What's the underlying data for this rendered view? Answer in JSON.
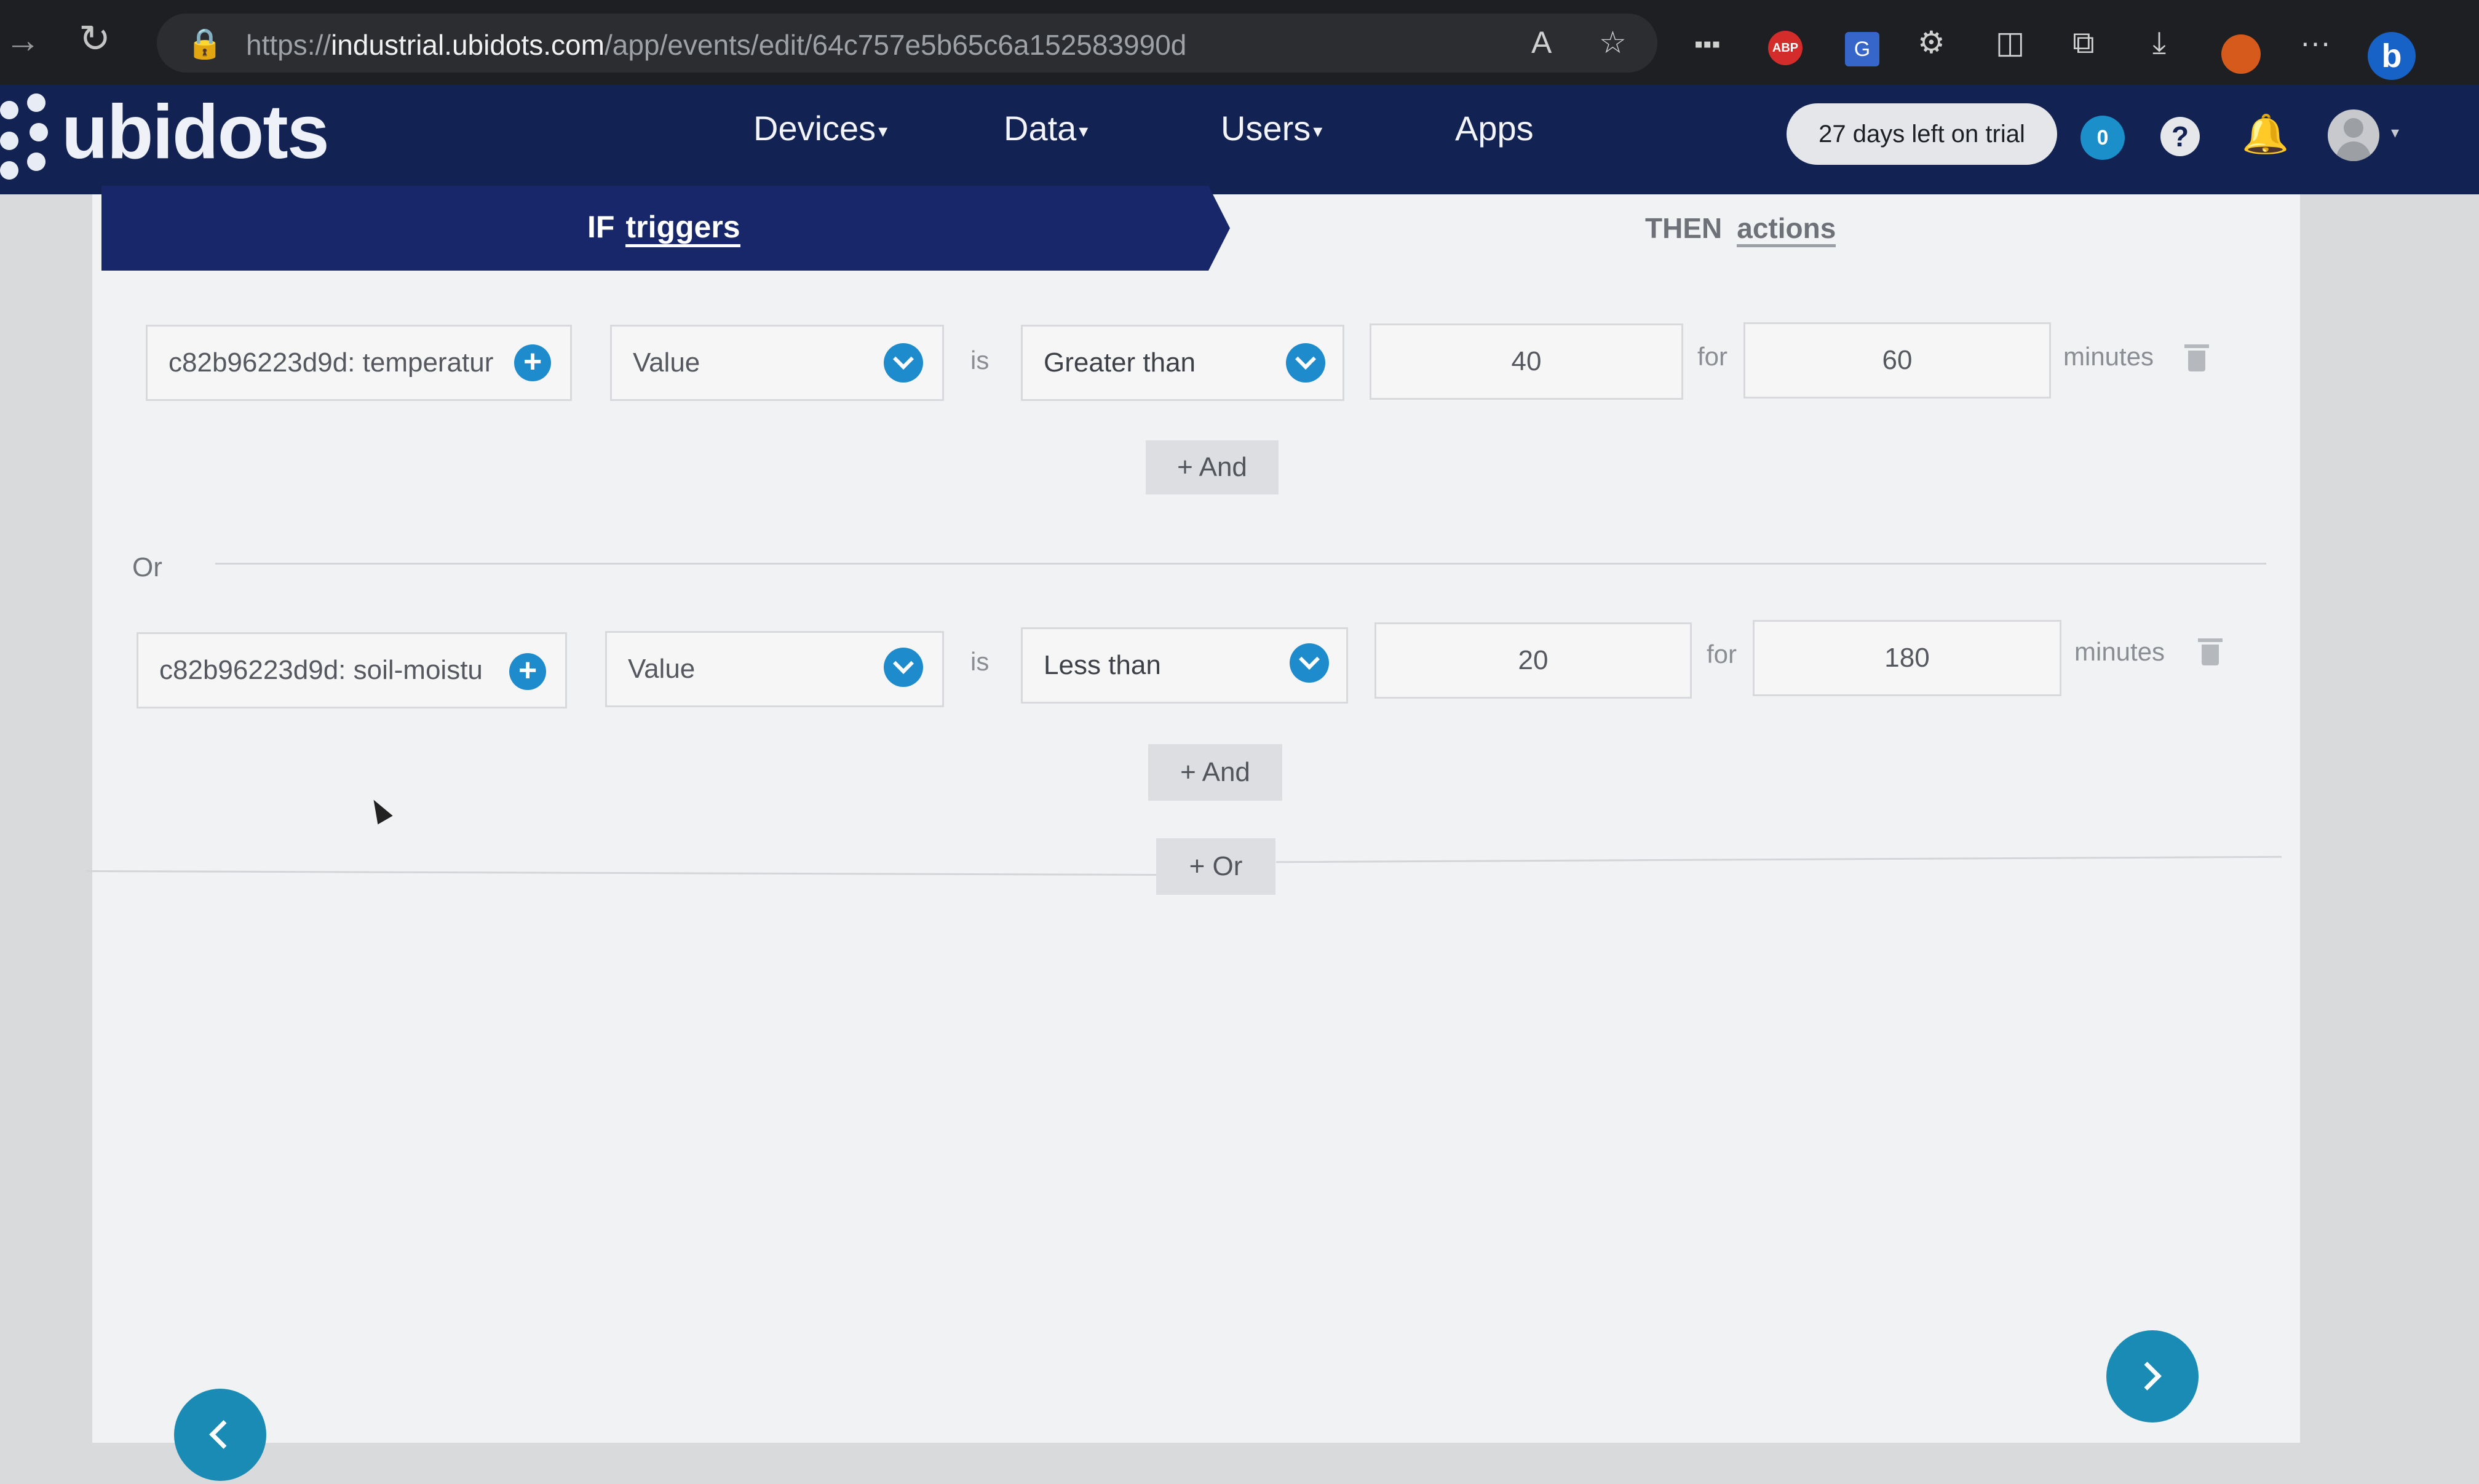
{
  "browser": {
    "url_prefix": "https://",
    "url_domain": "industrial.ubidots.com",
    "url_path": "/app/events/edit/64c757e5b65c6a152583990d",
    "icons": [
      "back-arrow-icon",
      "reload-icon",
      "lock-icon",
      "read-aloud-icon",
      "favorite-star-icon",
      "extension-icon",
      "adblock-icon",
      "translate-icon",
      "settings-extension-icon",
      "split-screen-icon",
      "collections-icon",
      "downloads-icon",
      "profile-icon",
      "more-icon",
      "bing-icon"
    ]
  },
  "app": {
    "logo": "ubidots",
    "nav": [
      {
        "label": "Devices",
        "has_caret": true
      },
      {
        "label": "Data",
        "has_caret": true
      },
      {
        "label": "Users",
        "has_caret": true
      },
      {
        "label": "Apps",
        "has_caret": false
      }
    ],
    "trial": "27 days left on trial",
    "notifications_count": "0"
  },
  "tabs": {
    "if_prefix": "IF",
    "if_label": "triggers",
    "then_prefix": "THEN",
    "then_label": "actions"
  },
  "conditions": [
    {
      "variable": "c82b96223d9d: temperatur",
      "metric": "Value",
      "is_label": "is",
      "operator": "Greater than",
      "threshold": "40",
      "for_label": "for",
      "duration": "60",
      "unit": "minutes",
      "and_button": "And"
    },
    {
      "variable": "c82b96223d9d: soil-moistu",
      "metric": "Value",
      "is_label": "is",
      "operator": "Less than",
      "threshold": "20",
      "for_label": "for",
      "duration": "180",
      "unit": "minutes",
      "and_button": "And"
    }
  ],
  "or_separator": "Or",
  "add_or_button": "Or",
  "colors": {
    "header_bg": "#122252",
    "active_tab_bg": "#17276a",
    "accent": "#1e8ccc",
    "nav_button": "#1a8bb4"
  }
}
